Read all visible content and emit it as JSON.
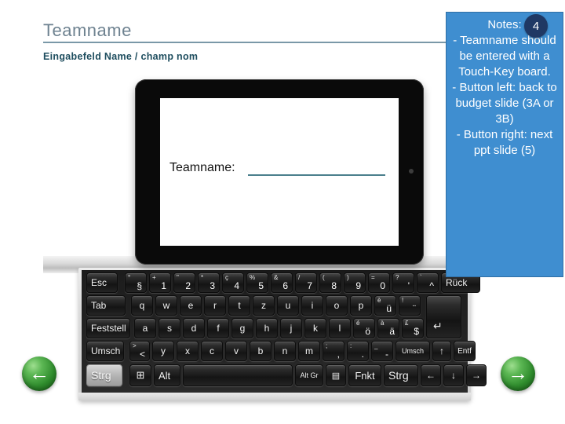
{
  "header": {
    "title": "Teamname",
    "subtitle": "Eingabefeld Name / champ nom"
  },
  "notes": {
    "badge": "4",
    "text": "Notes:\n-   Teamname should be entered with a Touch-Key board.\n-  Button left: back to budget slide (3A or 3B)\n-   Button right: next ppt slide (5)",
    "bg_color": "#3f8ed0",
    "badge_color": "#1f3864"
  },
  "tablet": {
    "screen_label": "Teamname:",
    "blank_line_color": "#4a7f8c"
  },
  "keyboard": {
    "rows": {
      "row1": [
        {
          "label": "Esc",
          "type": "text"
        },
        {
          "top": "°",
          "bot": "§",
          "type": "dual"
        },
        {
          "top": "+",
          "bot": "1",
          "type": "dual"
        },
        {
          "top": "\"",
          "bot": "2",
          "type": "dual"
        },
        {
          "top": "*",
          "bot": "3",
          "type": "dual"
        },
        {
          "top": "ç",
          "bot": "4",
          "type": "dual"
        },
        {
          "top": "%",
          "bot": "5",
          "type": "dual"
        },
        {
          "top": "&",
          "bot": "6",
          "type": "dual"
        },
        {
          "top": "/",
          "bot": "7",
          "type": "dual"
        },
        {
          "top": "(",
          "bot": "8",
          "type": "dual"
        },
        {
          "top": ")",
          "bot": "9",
          "type": "dual"
        },
        {
          "top": "=",
          "bot": "0",
          "type": "dual"
        },
        {
          "top": "?",
          "bot": "'",
          "type": "dual"
        },
        {
          "top": "`",
          "bot": "^",
          "type": "dual"
        },
        {
          "label": "Rück",
          "type": "text"
        }
      ],
      "row2": [
        {
          "label": "Tab",
          "type": "text"
        },
        {
          "label": "q",
          "type": "text"
        },
        {
          "label": "w",
          "type": "text"
        },
        {
          "label": "e",
          "type": "text"
        },
        {
          "label": "r",
          "type": "text"
        },
        {
          "label": "t",
          "type": "text"
        },
        {
          "label": "z",
          "type": "text"
        },
        {
          "label": "u",
          "type": "text"
        },
        {
          "label": "i",
          "type": "text"
        },
        {
          "label": "o",
          "type": "text"
        },
        {
          "label": "p",
          "type": "text"
        },
        {
          "top": "è",
          "bot": "ü",
          "type": "dual"
        },
        {
          "top": "!",
          "bot": "¨",
          "type": "dual"
        }
      ],
      "row3": [
        {
          "label": "Feststell",
          "type": "text"
        },
        {
          "label": "a",
          "type": "text"
        },
        {
          "label": "s",
          "type": "text"
        },
        {
          "label": "d",
          "type": "text"
        },
        {
          "label": "f",
          "type": "text"
        },
        {
          "label": "g",
          "type": "text"
        },
        {
          "label": "h",
          "type": "text"
        },
        {
          "label": "j",
          "type": "text"
        },
        {
          "label": "k",
          "type": "text"
        },
        {
          "label": "l",
          "type": "text"
        },
        {
          "top": "é",
          "bot": "ö",
          "type": "dual"
        },
        {
          "top": "à",
          "bot": "ä",
          "type": "dual"
        },
        {
          "top": "£",
          "bot": "$",
          "type": "dual"
        }
      ],
      "row4": [
        {
          "label": "Umsch",
          "type": "text"
        },
        {
          "top": ">",
          "bot": "<",
          "type": "dual"
        },
        {
          "label": "y",
          "type": "text"
        },
        {
          "label": "x",
          "type": "text"
        },
        {
          "label": "c",
          "type": "text"
        },
        {
          "label": "v",
          "type": "text"
        },
        {
          "label": "b",
          "type": "text"
        },
        {
          "label": "n",
          "type": "text"
        },
        {
          "label": "m",
          "type": "text"
        },
        {
          "top": ";",
          "bot": ",",
          "type": "dual"
        },
        {
          "top": ":",
          "bot": ".",
          "type": "dual"
        },
        {
          "top": "_",
          "bot": "-",
          "type": "dual"
        },
        {
          "label": "Umsch",
          "type": "text"
        },
        {
          "label": "↑",
          "type": "text"
        },
        {
          "label": "Entf",
          "type": "text"
        }
      ],
      "row5": [
        {
          "label": "Strg",
          "type": "text"
        },
        {
          "label": "⊞",
          "type": "text"
        },
        {
          "label": "Alt",
          "type": "text"
        },
        {
          "label": "",
          "type": "text"
        },
        {
          "label": "Alt Gr",
          "type": "text"
        },
        {
          "label": "▤",
          "type": "text"
        },
        {
          "label": "Fnkt",
          "type": "text"
        },
        {
          "label": "Strg",
          "type": "text"
        },
        {
          "label": "←",
          "type": "text"
        },
        {
          "label": "↓",
          "type": "text"
        },
        {
          "label": "→",
          "type": "text"
        }
      ]
    },
    "enter_label": "↵"
  },
  "nav": {
    "back_arrow": "←",
    "next_arrow": "→",
    "color": "#2e8b2c"
  }
}
